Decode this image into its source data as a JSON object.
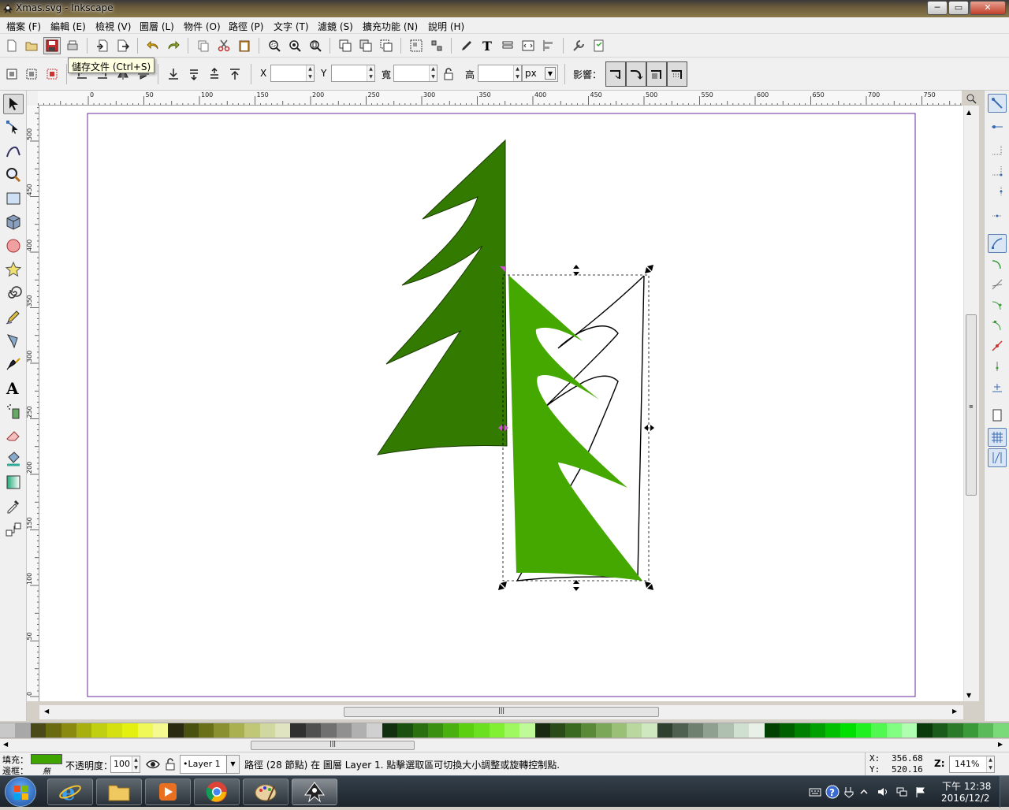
{
  "window": {
    "title": "Xmas.svg - Inkscape",
    "minimize": "─",
    "maximize": "▭",
    "close": "✕"
  },
  "menu": [
    "檔案 (F)",
    "編輯 (E)",
    "檢視 (V)",
    "圖層 (L)",
    "物件 (O)",
    "路徑 (P)",
    "文字 (T)",
    "濾鏡 (S)",
    "擴充功能 (N)",
    "說明 (H)"
  ],
  "tooltip": "儲存文件 (Ctrl+S)",
  "toolbar2": {
    "x_label": "X",
    "y_label": "Y",
    "w_label": "寬",
    "h_label": "高",
    "x_value": "",
    "y_value": "",
    "w_value": "",
    "h_value": "",
    "unit": "px",
    "affect_label": "影響："
  },
  "ruler": {
    "h_ticks": [
      "0",
      "50",
      "100",
      "150",
      "200",
      "250",
      "300",
      "350",
      "400",
      "450",
      "500",
      "550",
      "600",
      "650",
      "700",
      "750"
    ],
    "v_ticks": [
      "0",
      "50",
      "100",
      "150",
      "200",
      "250",
      "300",
      "350",
      "400",
      "450",
      "500",
      "550",
      "600",
      "650",
      "700"
    ]
  },
  "status": {
    "fill_label": "填充：",
    "stroke_label": "邊框：",
    "fill_color": "#3fa300",
    "stroke_value": "無",
    "opacity_label": "不透明度：",
    "opacity_value": "100",
    "layer_value": "•Layer 1",
    "message": "路徑 (28 節點) 在 圖層 Layer 1. 點擊選取區可切換大小調整或旋轉控制點.",
    "x_label": "X:",
    "x_value": "356.68",
    "y_label": "Y:",
    "y_value": "520.16",
    "z_label": "Z:",
    "zoom_value": "141%"
  },
  "colors": {
    "tree_dark": "#337b00",
    "tree_light": "#45a800",
    "page_border": "#6a2a9a",
    "handle_pink": "#cc55cc"
  },
  "palette": [
    "#c8c8c8",
    "#a8a8a8",
    "#4a4a18",
    "#6a6a10",
    "#8a8a10",
    "#a8b010",
    "#c0d010",
    "#d4e010",
    "#e4f010",
    "#f0f858",
    "#f4fa90",
    "#2a2a10",
    "#4a5010",
    "#6a7018",
    "#8a9030",
    "#a8b050",
    "#c0c878",
    "#d0d8a0",
    "#e0e4c0",
    "#303030",
    "#505050",
    "#707070",
    "#909090",
    "#b0b0b0",
    "#d0d0d0",
    "#103010",
    "#1a5010",
    "#2a7010",
    "#3a9010",
    "#4ab010",
    "#5ad010",
    "#6ae020",
    "#80f030",
    "#a0f860",
    "#c0fa98",
    "#1a2a10",
    "#2a4a18",
    "#3a6a20",
    "#5a8a38",
    "#7aa858",
    "#9ac078",
    "#b8d8a0",
    "#d0e8c0",
    "#304030",
    "#506050",
    "#708070",
    "#90a090",
    "#b0c0b0",
    "#d0e0d0",
    "#e8f0e8",
    "#004000",
    "#006000",
    "#008000",
    "#00a000",
    "#00c000",
    "#00e000",
    "#20f020",
    "#50f850",
    "#80ff80",
    "#b0ffb0",
    "#0a3a0a",
    "#1a5a1a",
    "#2a7a2a",
    "#3a9a3a",
    "#5aba5a",
    "#7ada7a"
  ],
  "taskbar": {
    "time": "下午 12:38",
    "date": "2016/12/2"
  }
}
